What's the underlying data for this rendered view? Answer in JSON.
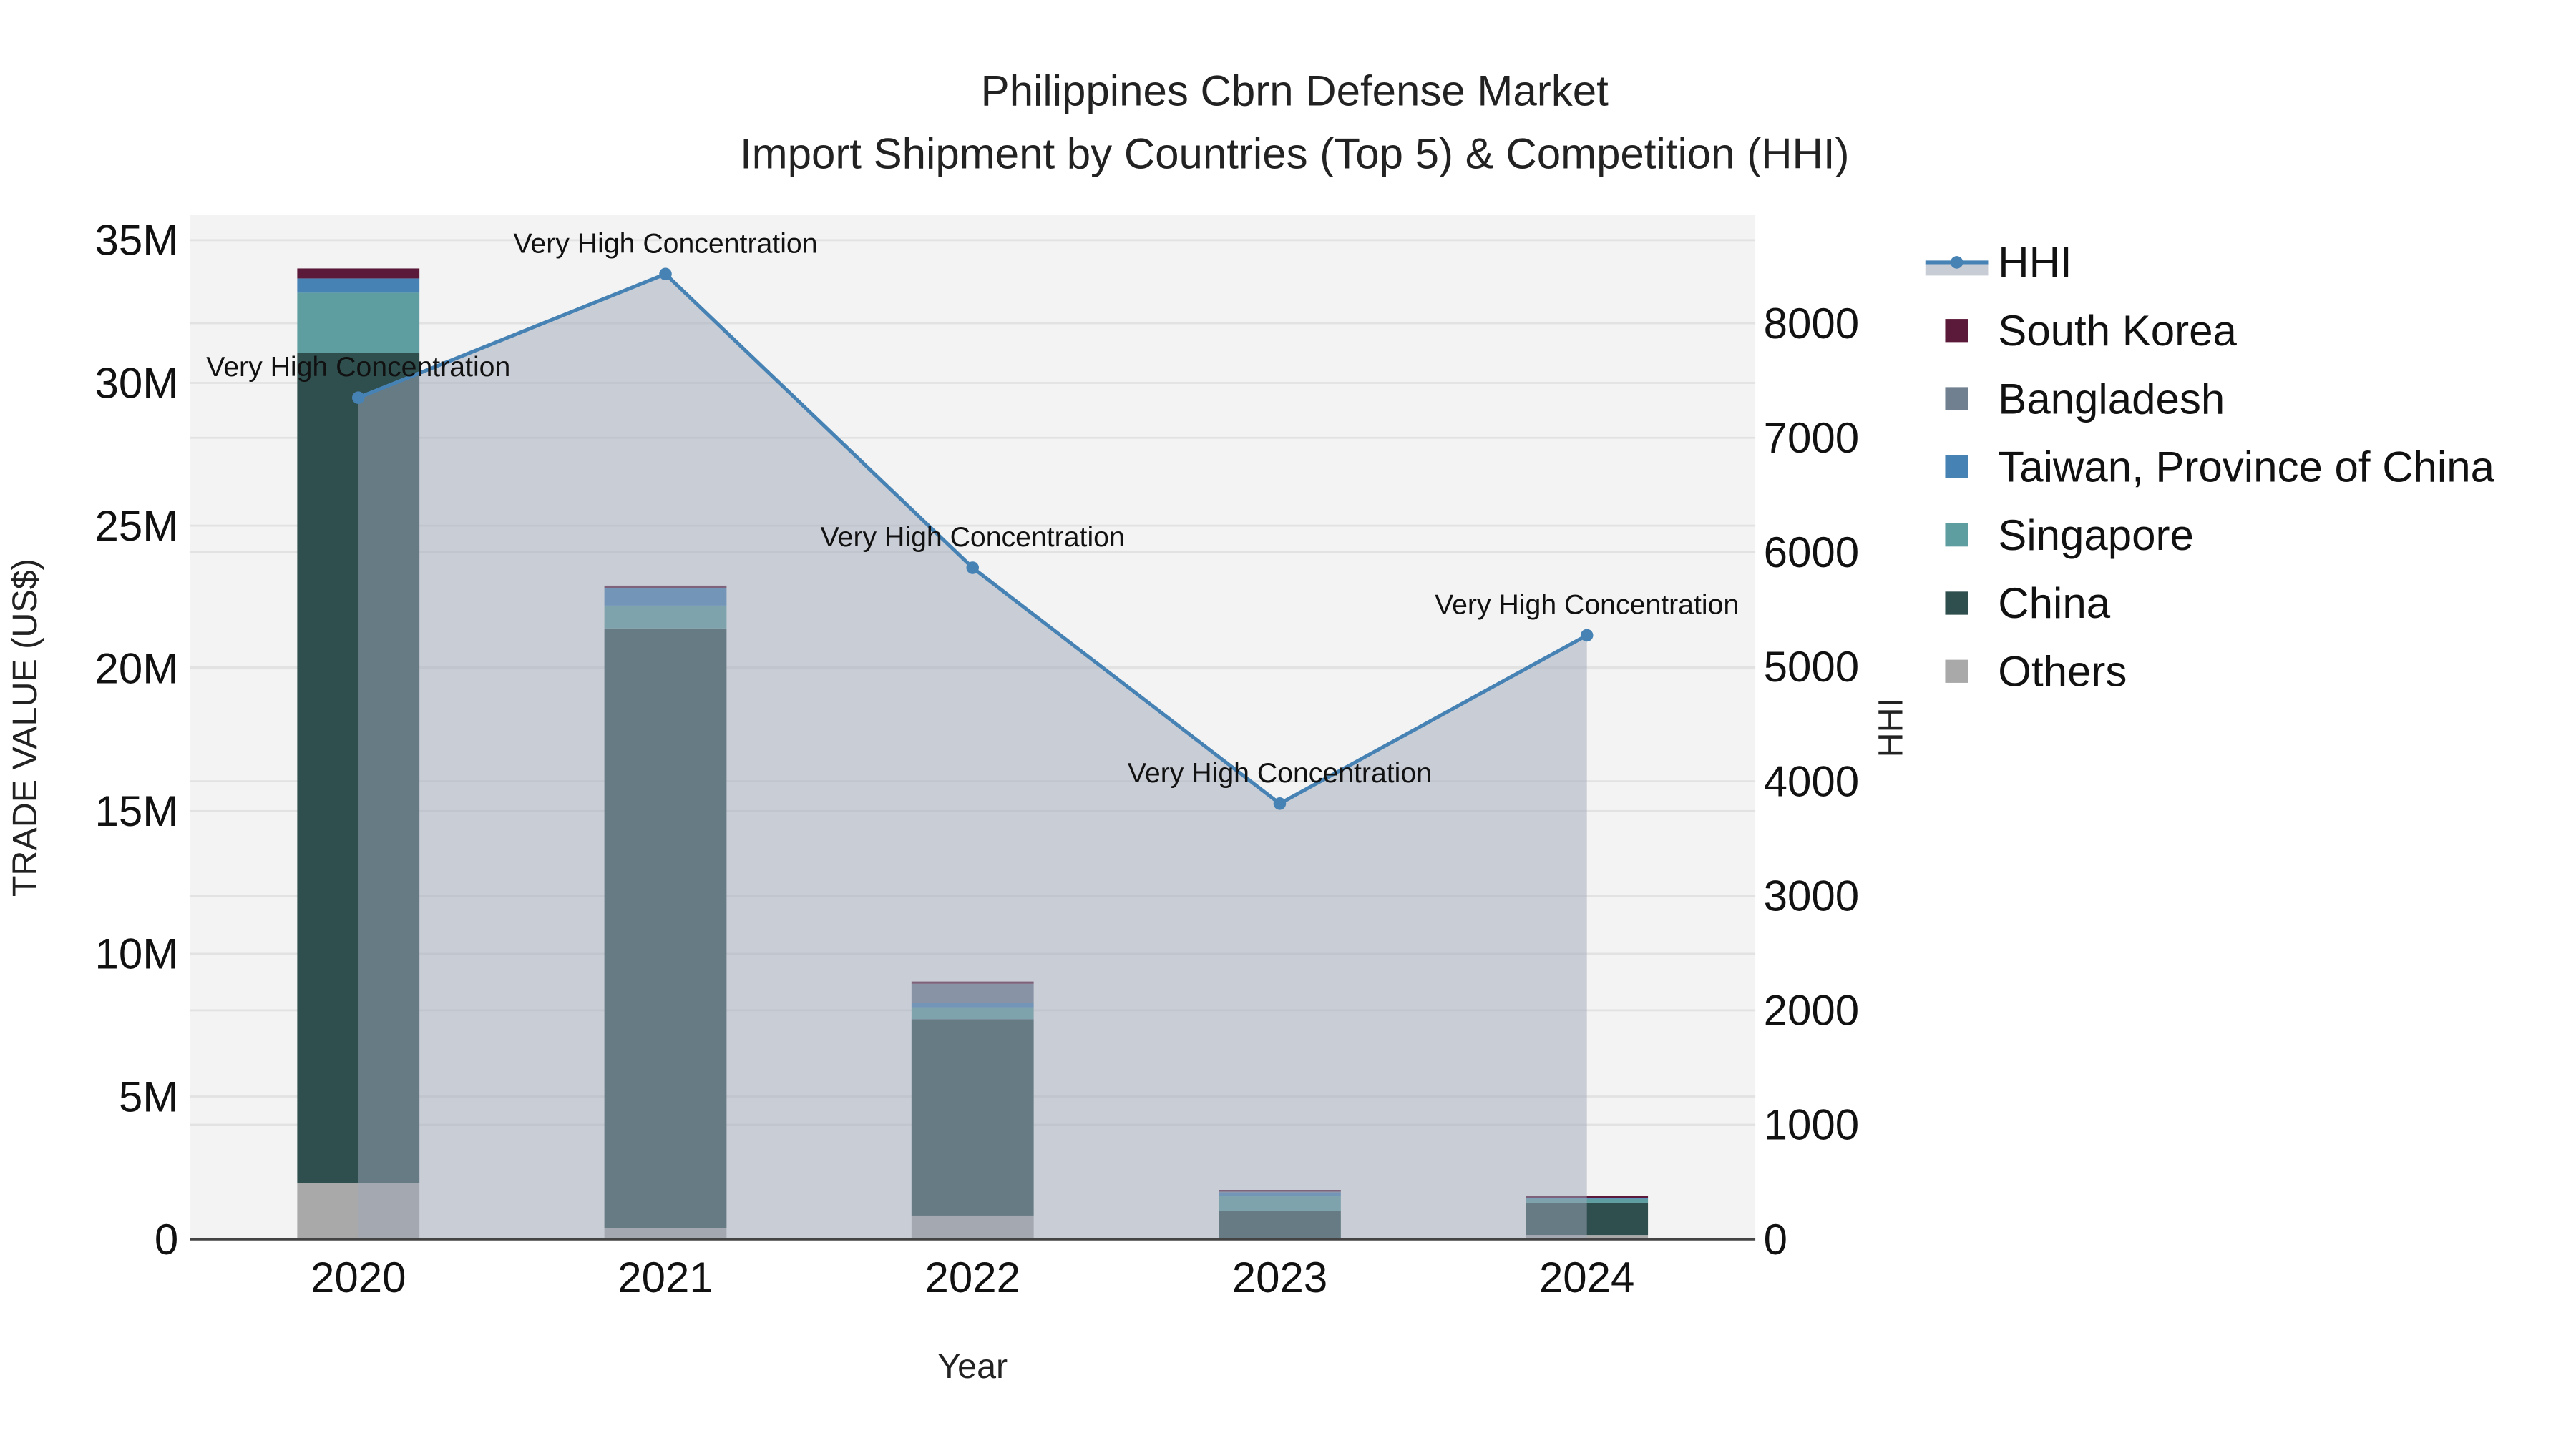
{
  "chart_data": {
    "type": "bar",
    "title": "Philippines Cbrn Defense Market",
    "subtitle": "Import Shipment by Countries (Top 5) & Competition (HHI)",
    "xlabel": "Year",
    "ylabel": "TRADE VALUE (US$)",
    "y2label": "HHI",
    "categories": [
      "2020",
      "2021",
      "2022",
      "2023",
      "2024"
    ],
    "ylim": [
      0,
      35900000
    ],
    "y2lim": [
      0,
      8950
    ],
    "yticks": [
      {
        "v": 0,
        "label": "0"
      },
      {
        "v": 5000000,
        "label": "5M"
      },
      {
        "v": 10000000,
        "label": "10M"
      },
      {
        "v": 15000000,
        "label": "15M"
      },
      {
        "v": 20000000,
        "label": "20M"
      },
      {
        "v": 25000000,
        "label": "25M"
      },
      {
        "v": 30000000,
        "label": "30M"
      },
      {
        "v": 35000000,
        "label": "35M"
      }
    ],
    "y2ticks": [
      {
        "v": 0,
        "label": "0"
      },
      {
        "v": 1000,
        "label": "1000"
      },
      {
        "v": 2000,
        "label": "2000"
      },
      {
        "v": 3000,
        "label": "3000"
      },
      {
        "v": 4000,
        "label": "4000"
      },
      {
        "v": 5000,
        "label": "5000"
      },
      {
        "v": 6000,
        "label": "6000"
      },
      {
        "v": 7000,
        "label": "7000"
      },
      {
        "v": 8000,
        "label": "8000"
      }
    ],
    "series": [
      {
        "name": "Others",
        "color": "#a9a9a9",
        "values": [
          1960000,
          400000,
          830000,
          50000,
          150000
        ]
      },
      {
        "name": "China",
        "color": "#2f4f4f",
        "values": [
          29100000,
          21000000,
          6880000,
          930000,
          1130000
        ]
      },
      {
        "name": "Singapore",
        "color": "#5f9ea0",
        "values": [
          2100000,
          800000,
          420000,
          550000,
          130000
        ]
      },
      {
        "name": "Taiwan, Province of China",
        "color": "#4682b4",
        "values": [
          500000,
          600000,
          160000,
          110000,
          40000
        ]
      },
      {
        "name": "Bangladesh",
        "color": "#708090",
        "values": [
          0,
          0,
          660000,
          30000,
          0
        ]
      },
      {
        "name": "South Korea",
        "color": "#5c1a3a",
        "values": [
          350000,
          100000,
          80000,
          60000,
          80000
        ]
      }
    ],
    "hhi": {
      "name": "HHI",
      "color": "#4682b4",
      "values": [
        7350,
        8430,
        5865,
        3805,
        5275
      ],
      "annotations": [
        "Very High Concentration",
        "Very High Concentration",
        "Very High Concentration",
        "Very High Concentration",
        "Very High Concentration"
      ]
    },
    "legend_order": [
      "HHI",
      "South Korea",
      "Bangladesh",
      "Taiwan, Province of China",
      "Singapore",
      "China",
      "Others"
    ],
    "legend_placement": "right",
    "grid": true
  }
}
